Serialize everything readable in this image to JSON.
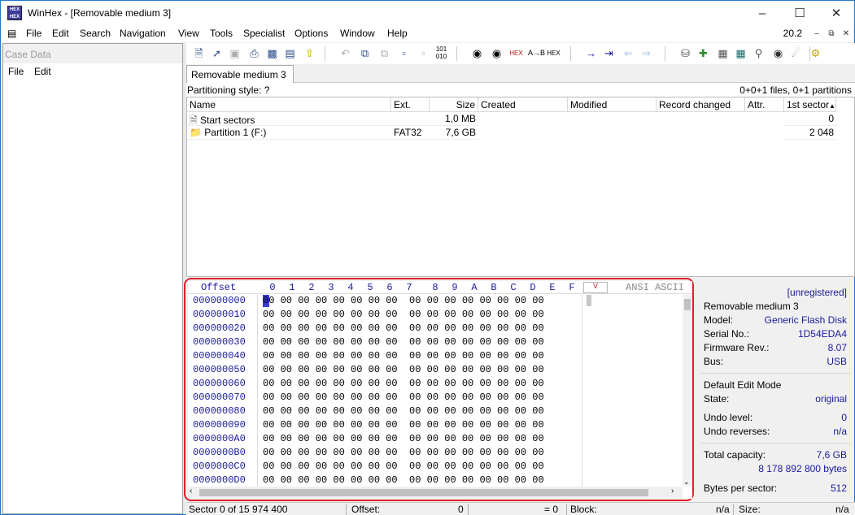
{
  "window": {
    "title": "WinHex - [Removable medium 3]"
  },
  "menu": {
    "items": [
      "File",
      "Edit",
      "Search",
      "Navigation",
      "View",
      "Tools",
      "Specialist",
      "Options",
      "Window",
      "Help"
    ],
    "version": "20.2"
  },
  "case_pane": {
    "title": "Case Data",
    "menu": [
      "File",
      "Edit"
    ]
  },
  "toolbar": {
    "icons": [
      "new-file-icon",
      "open-icon",
      "save-icon",
      "print-icon",
      "properties-icon",
      "clipboard-icon",
      "export-icon",
      "undo-icon",
      "copy-icon",
      "cut-icon",
      "paste-icon",
      "paste-special-icon",
      "binary-icon",
      "find-icon",
      "find-text-icon",
      "find-hex-icon",
      "replace-text-icon",
      "replace-hex-icon",
      "goto-offset-icon",
      "goto-sector-icon",
      "back-icon",
      "forward-icon",
      "open-disk-icon",
      "disk-plus-icon",
      "ram-icon",
      "calculator-icon",
      "search-icon",
      "analyze-icon",
      "tools-icon",
      "settings-icon"
    ]
  },
  "tab": {
    "label": "Removable medium 3"
  },
  "info_bar": {
    "left": "Partitioning style: ?",
    "right": "0+0+1 files, 0+1 partitions"
  },
  "file_table": {
    "columns": [
      "Name",
      "Ext.",
      "Size",
      "Created",
      "Modified",
      "Record changed",
      "Attr.",
      "1st sector"
    ],
    "rows": [
      {
        "name": "Start sectors",
        "ext": "",
        "size": "1,0 MB",
        "sector": "0"
      },
      {
        "name": "Partition 1 (F:)",
        "ext": "FAT32",
        "size": "7,6 GB",
        "sector": "2 048"
      }
    ]
  },
  "hex": {
    "offset_label": "Offset",
    "columns": [
      "0",
      "1",
      "2",
      "3",
      "4",
      "5",
      "6",
      "7",
      "8",
      "9",
      "A",
      "B",
      "C",
      "D",
      "E",
      "F"
    ],
    "v_button": "V",
    "ansi_label": "ANSI ASCII",
    "offsets": [
      "000000000",
      "000000010",
      "000000020",
      "000000030",
      "000000040",
      "000000050",
      "000000060",
      "000000070",
      "000000080",
      "000000090",
      "0000000A0",
      "0000000B0",
      "0000000C0",
      "0000000D0"
    ],
    "rowtext": "00 00 00 00 00 00 00 00  00 00 00 00 00 00 00 00"
  },
  "info_panel": {
    "registration": "[unregistered]",
    "device": "Removable medium 3",
    "model_label": "Model:",
    "model": "Generic Flash Disk",
    "serial_label": "Serial No.:",
    "serial": "1D54EDA4",
    "firmware_label": "Firmware Rev.:",
    "firmware": "8.07",
    "bus_label": "Bus:",
    "bus": "USB",
    "mode": "Default Edit Mode",
    "state_label": "State:",
    "state": "original",
    "undo_label": "Undo level:",
    "undo": "0",
    "undo_rev_label": "Undo reverses:",
    "undo_rev": "n/a",
    "capacity_label": "Total capacity:",
    "capacity": "7,6 GB",
    "capacity_bytes": "8 178 892 800 bytes",
    "bps_label": "Bytes per sector:",
    "bps": "512"
  },
  "status": {
    "sector": "Sector 0 of 15 974 400",
    "offset_label": "Offset:",
    "offset": "0",
    "eq": "= 0",
    "block_label": "Block:",
    "block": "n/a",
    "size_label": "Size:",
    "size": "n/a"
  },
  "colors": {
    "accent": "#1e79c8",
    "highlight": "#e0202a",
    "hex_blue": "#1a1a9a"
  }
}
